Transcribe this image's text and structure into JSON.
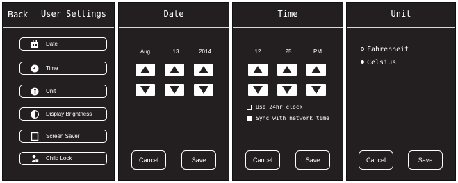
{
  "settings": {
    "back_label": "Back",
    "title": "User Settings",
    "items": [
      {
        "label": "Date",
        "icon": "calendar-icon"
      },
      {
        "label": "Time",
        "icon": "clock-icon"
      },
      {
        "label": "Unit",
        "icon": "thermometer-icon"
      },
      {
        "label": "Display Brightness",
        "icon": "brightness-icon"
      },
      {
        "label": "Screen Saver",
        "icon": "monitor-icon"
      },
      {
        "label": "Child Lock",
        "icon": "lock-icon"
      }
    ]
  },
  "date": {
    "title": "Date",
    "month": "Aug",
    "day": "13",
    "year": "2014",
    "cancel_label": "Cancel",
    "save_label": "Save"
  },
  "time": {
    "title": "Time",
    "hour": "12",
    "minute": "25",
    "period": "PM",
    "options": [
      {
        "label": "Use 24hr clock",
        "checked": false
      },
      {
        "label": "Sync with network time",
        "checked": true
      }
    ],
    "cancel_label": "Cancel",
    "save_label": "Save"
  },
  "unit": {
    "title": "Unit",
    "options": [
      {
        "label": "Fahrenheit",
        "selected": false
      },
      {
        "label": "Celsius",
        "selected": true
      }
    ],
    "cancel_label": "Cancel",
    "save_label": "Save"
  },
  "colors": {
    "panel_bg": "#231f20",
    "foreground": "#ffffff"
  }
}
